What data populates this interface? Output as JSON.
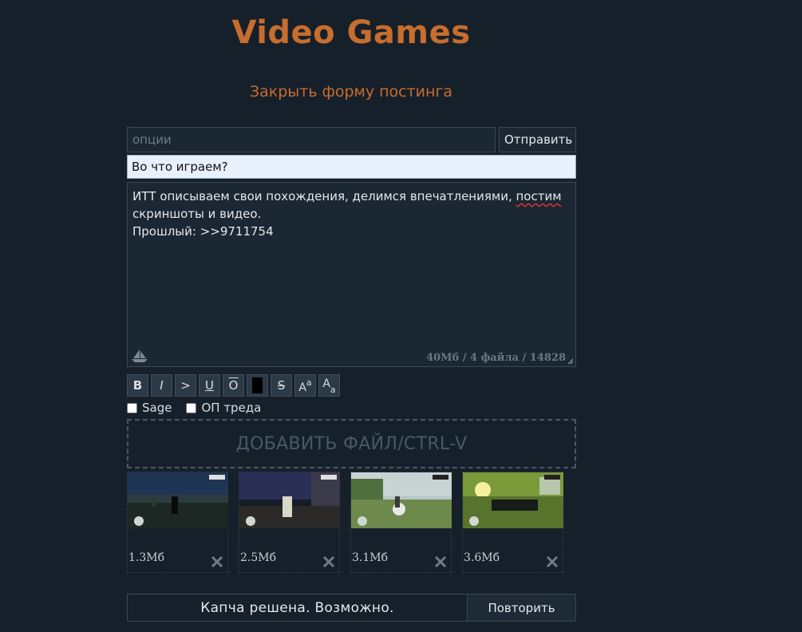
{
  "board": {
    "title": "Video Games",
    "close_form_label": "Закрыть форму постинга"
  },
  "form": {
    "options_placeholder": "опции",
    "submit_label": "Отправить",
    "subject_value": "Во что играем?",
    "message": {
      "line1_before": "ИТТ описываем свои похождения, делимся впечатлениями, ",
      "line1_misspelled": "постим",
      "line2": "скриншоты и видео.",
      "line3": "Прошлый: >>9711754"
    },
    "counter": "40Мб / 4 файла / 14828",
    "toolbar": [
      "B",
      "I",
      ">",
      "U",
      "O",
      "",
      "S",
      "Aa",
      "Aa"
    ],
    "checkboxes": {
      "sage_label": "Sage",
      "op_label": "ОП треда"
    },
    "dropzone_label": "ДОБАВИТЬ ФАЙЛ/CTRL-V",
    "files": [
      {
        "size": "1.3Мб"
      },
      {
        "size": "2.5Мб"
      },
      {
        "size": "3.1Мб"
      },
      {
        "size": "3.6Мб"
      }
    ]
  },
  "captcha": {
    "status": "Капча решена. Возможно.",
    "retry_label": "Повторить"
  },
  "colors": {
    "background": "#16202a",
    "accent": "#c76d2e",
    "subject_bg": "#e8f0fc"
  }
}
